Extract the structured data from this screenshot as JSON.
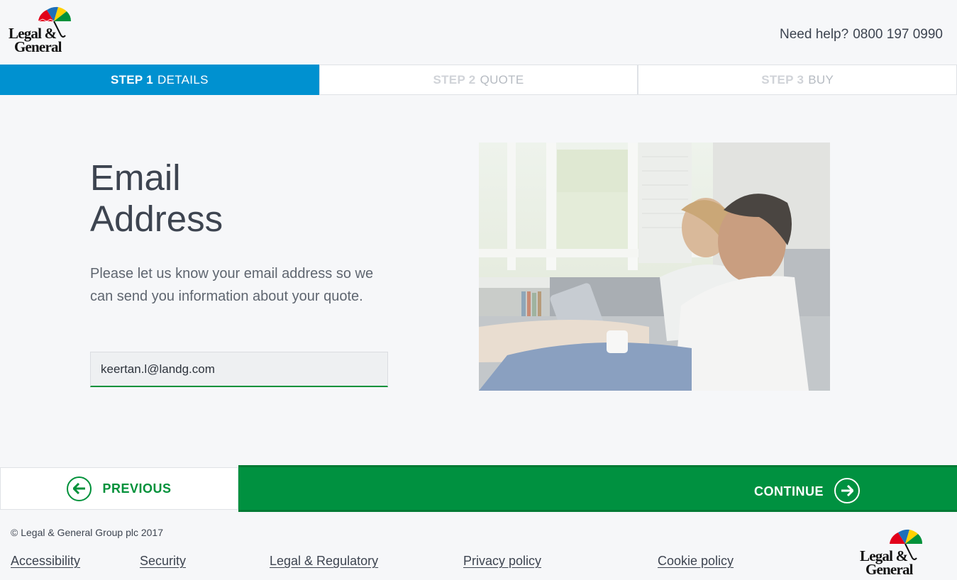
{
  "header": {
    "logo": {
      "line1": "Legal &",
      "line2": "General"
    },
    "help_label": "Need help?",
    "phone": "0800 197 0990"
  },
  "steps": [
    {
      "num": "STEP 1",
      "label": "DETAILS",
      "active": true
    },
    {
      "num": "STEP 2",
      "label": "QUOTE",
      "active": false
    },
    {
      "num": "STEP 3",
      "label": "BUY",
      "active": false
    }
  ],
  "main": {
    "title_line1": "Email",
    "title_line2": "Address",
    "description": "Please let us know your email address so we can send you information about your quote.",
    "email_value": "keertan.l@landg.com"
  },
  "nav": {
    "previous_label": "PREVIOUS",
    "continue_label": "CONTINUE"
  },
  "footer": {
    "copyright": "© Legal & General Group plc 2017",
    "links": [
      "Accessibility",
      "Security",
      "Legal & Regulatory",
      "Privacy policy",
      "Cookie policy"
    ]
  },
  "colors": {
    "step_active": "#0091d0",
    "primary_green": "#009140",
    "text": "#3d4450"
  },
  "icons": {
    "logo": "umbrella-icon",
    "previous": "arrow-left-circle-icon",
    "continue": "arrow-right-circle-icon"
  }
}
